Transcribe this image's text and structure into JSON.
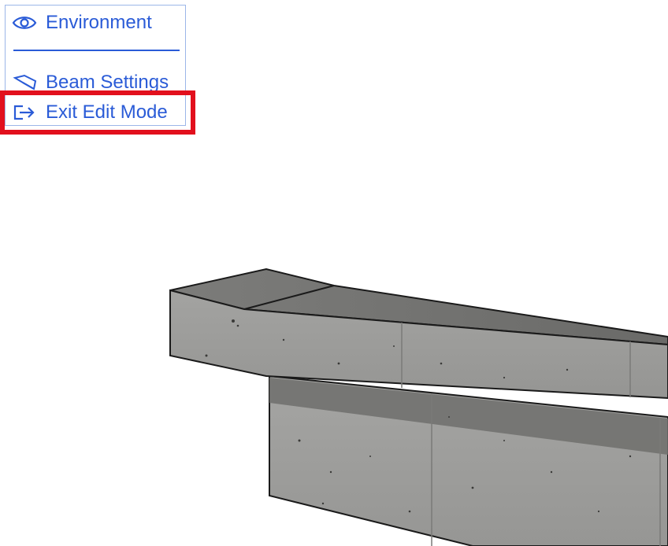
{
  "menu": {
    "items": [
      {
        "label": "Environment",
        "icon": "eye-icon"
      },
      {
        "label": "Beam Settings",
        "icon": "beam-icon"
      },
      {
        "label": "Exit Edit Mode",
        "icon": "exit-icon"
      }
    ],
    "accent_color": "#2a5bd7",
    "highlight_color": "#e2101d"
  },
  "scene": {
    "object": "concrete-beam",
    "material_color": "#9a9a98"
  }
}
